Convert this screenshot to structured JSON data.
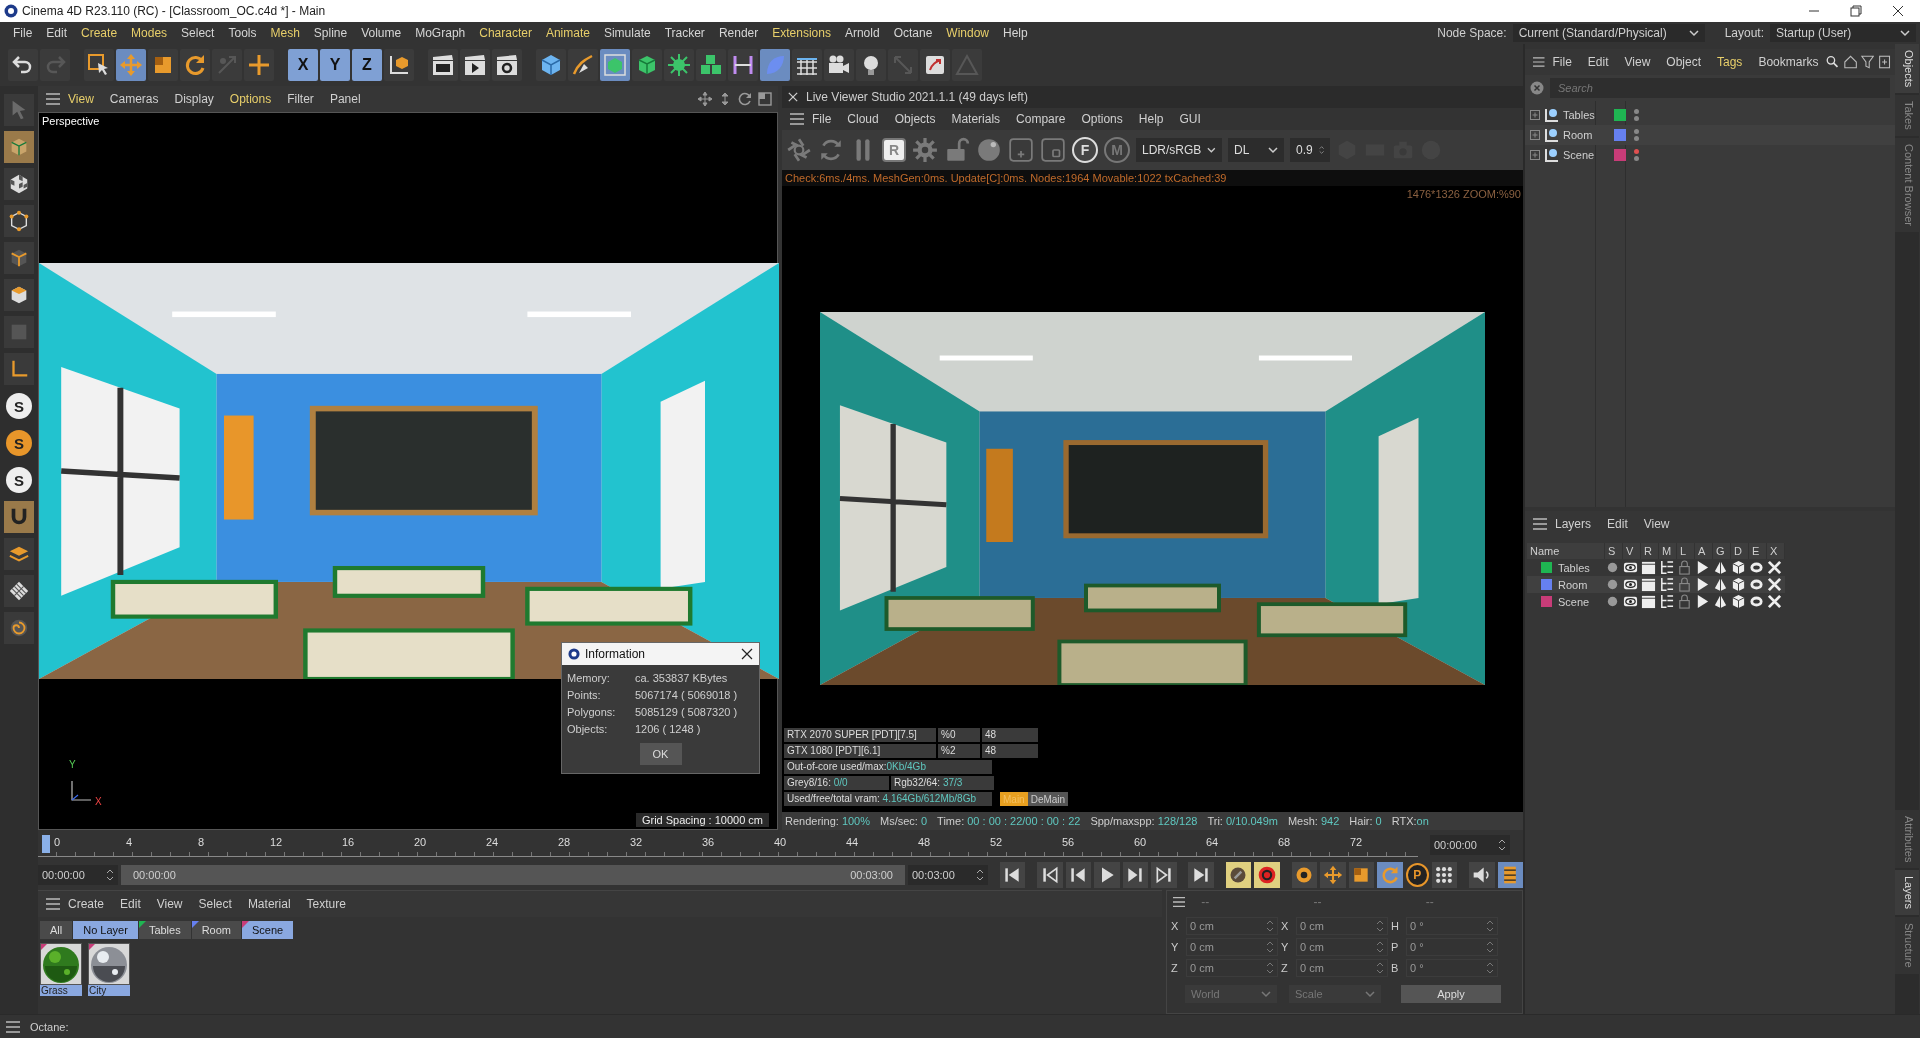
{
  "window": {
    "title": "Cinema 4D R23.110 (RC) - [Classroom_OC.c4d *] - Main"
  },
  "menu": [
    {
      "label": "File",
      "accent": false
    },
    {
      "label": "Edit",
      "accent": false
    },
    {
      "label": "Create",
      "accent": true
    },
    {
      "label": "Modes",
      "accent": true
    },
    {
      "label": "Select",
      "accent": false
    },
    {
      "label": "Tools",
      "accent": false
    },
    {
      "label": "Mesh",
      "accent": true
    },
    {
      "label": "Spline",
      "accent": false
    },
    {
      "label": "Volume",
      "accent": false
    },
    {
      "label": "MoGraph",
      "accent": false
    },
    {
      "label": "Character",
      "accent": true
    },
    {
      "label": "Animate",
      "accent": true
    },
    {
      "label": "Simulate",
      "accent": false
    },
    {
      "label": "Tracker",
      "accent": false
    },
    {
      "label": "Render",
      "accent": false
    },
    {
      "label": "Extensions",
      "accent": true
    },
    {
      "label": "Arnold",
      "accent": false
    },
    {
      "label": "Octane",
      "accent": false
    },
    {
      "label": "Window",
      "accent": true
    },
    {
      "label": "Help",
      "accent": false
    }
  ],
  "node_space": {
    "label": "Node Space:",
    "value": "Current (Standard/Physical)"
  },
  "layout": {
    "label": "Layout:",
    "value": "Startup (User)"
  },
  "toolbar": [
    {
      "active": false,
      "disabled": false
    },
    {
      "active": false,
      "disabled": true
    },
    {
      "active": false,
      "disabled": false
    },
    {
      "active": true,
      "disabled": false
    },
    {
      "active": false,
      "disabled": false
    },
    {
      "active": false,
      "disabled": false
    },
    {
      "active": false,
      "disabled": true
    },
    {
      "active": false,
      "disabled": false
    },
    {
      "active": true,
      "disabled": false,
      "label": "X"
    },
    {
      "active": true,
      "disabled": false,
      "label": "Y"
    },
    {
      "active": true,
      "disabled": false,
      "label": "Z"
    },
    {
      "active": false,
      "disabled": false
    },
    {
      "active": false,
      "disabled": false
    },
    {
      "active": false,
      "disabled": false
    },
    {
      "active": false,
      "disabled": false
    },
    {
      "active": false,
      "disabled": false
    },
    {
      "active": false,
      "disabled": false
    },
    {
      "active": true,
      "disabled": false
    },
    {
      "active": false,
      "disabled": false
    },
    {
      "active": false,
      "disabled": false
    },
    {
      "active": false,
      "disabled": false
    },
    {
      "active": false,
      "disabled": false
    },
    {
      "active": true,
      "disabled": false
    },
    {
      "active": false,
      "disabled": false
    },
    {
      "active": false,
      "disabled": false
    },
    {
      "active": false,
      "disabled": false
    },
    {
      "active": false,
      "disabled": true
    },
    {
      "active": false,
      "disabled": false
    },
    {
      "active": false,
      "disabled": true
    }
  ],
  "left_tools": [
    {
      "active": false
    },
    {
      "active": true
    },
    {
      "active": false
    },
    {
      "active": false
    },
    {
      "active": false
    },
    {
      "active": false
    },
    {
      "active": false
    },
    {
      "active": false
    },
    {
      "active": false,
      "label": "S"
    },
    {
      "active": false,
      "label": "S"
    },
    {
      "active": false,
      "label": "S"
    },
    {
      "active": true
    },
    {
      "active": false
    },
    {
      "active": false
    },
    {
      "active": false
    }
  ],
  "viewport": {
    "menu": [
      {
        "label": "View",
        "accent": true
      },
      {
        "label": "Cameras",
        "accent": false
      },
      {
        "label": "Display",
        "accent": false
      },
      {
        "label": "Options",
        "accent": true
      },
      {
        "label": "Filter",
        "accent": false
      },
      {
        "label": "Panel",
        "accent": false
      }
    ],
    "camera": "Perspective",
    "grid": "Grid Spacing : 10000 cm",
    "axes": [
      "Y",
      "X"
    ]
  },
  "info_dialog": {
    "title": "Information",
    "rows": [
      {
        "label": "Memory:",
        "value": "ca. 353837 KBytes"
      },
      {
        "label": "Points:",
        "value": "5067174 ( 5069018 )"
      },
      {
        "label": "Polygons:",
        "value": "5085129 ( 5087320 )"
      },
      {
        "label": "Objects:",
        "value": "1206 ( 1248 )"
      }
    ],
    "button": "OK"
  },
  "live_viewer": {
    "title": "Live Viewer Studio 2021.1.1 (49 days left)",
    "menu": [
      "File",
      "Cloud",
      "Objects",
      "Materials",
      "Compare",
      "Options",
      "Help",
      "GUI"
    ],
    "tools": [
      {
        "kind": "icon",
        "disabled": false
      },
      {
        "kind": "icon",
        "disabled": false
      },
      {
        "kind": "icon",
        "disabled": false
      },
      {
        "kind": "letter",
        "label": "R",
        "disabled": false
      },
      {
        "kind": "icon",
        "disabled": false
      },
      {
        "kind": "icon",
        "disabled": false
      },
      {
        "kind": "icon",
        "disabled": false
      },
      {
        "kind": "icon",
        "disabled": false
      },
      {
        "kind": "icon",
        "disabled": false
      },
      {
        "kind": "letter",
        "label": "F",
        "disabled": false
      },
      {
        "kind": "letter",
        "label": "M",
        "disabled": true
      }
    ],
    "selects": [
      "LDR/sRGB",
      "DL"
    ],
    "spin": "0.9",
    "extra_tools": [
      {
        "disabled": true
      },
      {
        "disabled": true
      },
      {
        "disabled": true
      },
      {
        "disabled": true
      }
    ],
    "check_line": "Check:6ms./4ms. MeshGen:0ms. Update[C]:0ms. Nodes:1964 Movable:1022 txCached:39",
    "zoom_info": "1476*1326 ZOOM:%90",
    "gpus": [
      {
        "name": "RTX 2070 SUPER [PDT][7.5]",
        "usage": "%0",
        "temp": "48"
      },
      {
        "name": "GTX 1080 [PDT][6.1]",
        "usage": "%2",
        "temp": "48"
      }
    ],
    "out_of_core": {
      "label": "Out-of-core used/max:",
      "value": "0Kb/4Gb"
    },
    "textures": [
      {
        "label": "Grey8/16: ",
        "value": "0/0"
      },
      {
        "label": "Rgb32/64: ",
        "value": "37/3"
      }
    ],
    "vram": {
      "label": "Used/free/total vram: ",
      "value": "4.164Gb/612Mb/8Gb"
    },
    "tabs": [
      {
        "label": "Main",
        "selected": true
      },
      {
        "label": "DeMain",
        "selected": false
      }
    ],
    "render_status": [
      {
        "label": "Rendering: ",
        "value": "100%"
      },
      {
        "label": "Ms/sec: ",
        "value": "0"
      },
      {
        "label": "Time: ",
        "value": "00 : 00 : 22/00 : 00 : 22"
      },
      {
        "label": "Spp/maxspp: ",
        "value": "128/128"
      },
      {
        "label": "Tri: ",
        "value": "0/10.049m"
      },
      {
        "label": "Mesh: ",
        "value": "942"
      },
      {
        "label": "Hair: ",
        "value": "0"
      },
      {
        "label": "RTX:",
        "value": "on"
      }
    ]
  },
  "objects": {
    "menu": [
      {
        "label": "File",
        "accent": false
      },
      {
        "label": "Edit",
        "accent": false
      },
      {
        "label": "View",
        "accent": false
      },
      {
        "label": "Object",
        "accent": false
      },
      {
        "label": "Tags",
        "accent": true
      },
      {
        "label": "Bookmarks",
        "accent": false
      }
    ],
    "search": {
      "placeholder": "Search"
    },
    "items": [
      {
        "name": "Tables",
        "color": "#1fb552",
        "editor_visible": true
      },
      {
        "name": "Room",
        "color": "#6680f0",
        "editor_visible": true
      },
      {
        "name": "Scene",
        "color": "#c83c78",
        "editor_visible": false
      }
    ]
  },
  "layers": {
    "menu": [
      "Layers",
      "Edit",
      "View"
    ],
    "columns": [
      "Name",
      "S",
      "V",
      "R",
      "M",
      "L",
      "A",
      "G",
      "D",
      "E",
      "X"
    ],
    "rows": [
      {
        "name": "Tables",
        "color": "#1fb552"
      },
      {
        "name": "Room",
        "color": "#6680f0"
      },
      {
        "name": "Scene",
        "color": "#c83c78"
      }
    ]
  },
  "side_tabs_top": [
    {
      "label": "Objects",
      "selected": true
    },
    {
      "label": "Takes",
      "selected": false
    },
    {
      "label": "Content Browser",
      "selected": false
    }
  ],
  "side_tabs_bottom": [
    {
      "label": "Attributes",
      "selected": false
    },
    {
      "label": "Layers",
      "selected": true
    },
    {
      "label": "Structure",
      "selected": false
    }
  ],
  "timeline": {
    "ticks": [
      "0",
      "4",
      "8",
      "12",
      "16",
      "20",
      "24",
      "28",
      "32",
      "36",
      "40",
      "44",
      "48",
      "52",
      "56",
      "60",
      "64",
      "68",
      "72"
    ],
    "playhead": {
      "level": 0
    },
    "current": "00:00:00"
  },
  "range": {
    "level": 1,
    "start": "00:00:00",
    "slider_start": "00:00:00",
    "slider_end": "00:03:00",
    "end": "00:03:00"
  },
  "transport": [
    {
      "active": false
    },
    {
      "active": false
    },
    {
      "active": false
    },
    {
      "active": false
    },
    {
      "active": false
    },
    {
      "active": false
    },
    {
      "active": false
    },
    {
      "active": true
    },
    {
      "active": true
    },
    {
      "active": false
    },
    {
      "active": false
    },
    {
      "active": false
    },
    {
      "active": true
    },
    {
      "active": false,
      "label": "P"
    },
    {
      "active": false
    },
    {
      "active": false
    },
    {
      "active": true
    }
  ],
  "materials": {
    "menu": [
      "Create",
      "Edit",
      "View",
      "Select",
      "Material",
      "Texture"
    ],
    "filters": [
      {
        "label": "All",
        "selected": false
      },
      {
        "label": "No Layer",
        "selected": true
      },
      {
        "label": "Tables",
        "selected": false,
        "color": "#1fb552"
      },
      {
        "label": "Room",
        "selected": false,
        "color": "#6680f0"
      },
      {
        "label": "Scene",
        "selected": true,
        "color": "#c83c78"
      }
    ],
    "items": [
      {
        "name": "Grass",
        "selected": true
      },
      {
        "name": "City",
        "selected": true
      }
    ]
  },
  "coordinates": {
    "headers": [
      "--",
      "--",
      "--"
    ],
    "columns": [
      [
        {
          "axis": "X",
          "value": "0 cm"
        },
        {
          "axis": "Y",
          "value": "0 cm"
        },
        {
          "axis": "Z",
          "value": "0 cm"
        }
      ],
      [
        {
          "axis": "X",
          "value": "0 cm"
        },
        {
          "axis": "Y",
          "value": "0 cm"
        },
        {
          "axis": "Z",
          "value": "0 cm"
        }
      ],
      [
        {
          "axis": "H",
          "value": "0 °"
        },
        {
          "axis": "P",
          "value": "0 °"
        },
        {
          "axis": "B",
          "value": "0 °"
        }
      ]
    ],
    "dropdowns": [
      "World",
      "Scale"
    ],
    "apply": "Apply"
  },
  "status_bar": "Octane:"
}
